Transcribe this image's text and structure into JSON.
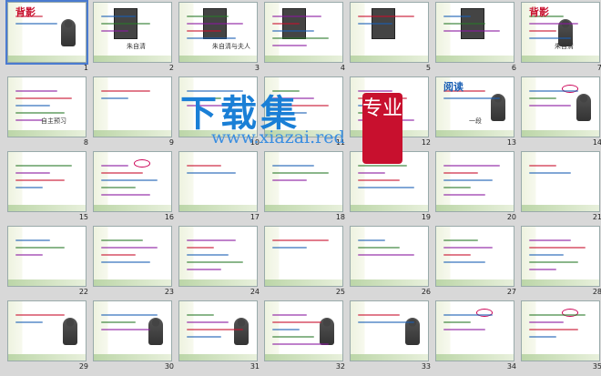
{
  "watermark": {
    "title": "下载集",
    "url": "www.xiazai.red",
    "stamp": "专业"
  },
  "slides": [
    {
      "n": "1",
      "title": "背影",
      "caption": ""
    },
    {
      "n": "2",
      "title": "",
      "caption": "朱自清"
    },
    {
      "n": "3",
      "title": "",
      "caption": "朱自清与夫人"
    },
    {
      "n": "4",
      "title": "",
      "caption": ""
    },
    {
      "n": "5",
      "title": "",
      "caption": ""
    },
    {
      "n": "6",
      "title": "",
      "caption": ""
    },
    {
      "n": "7",
      "title": "背影",
      "caption": "朱自清"
    },
    {
      "n": "8",
      "title": "",
      "caption": "自主预习"
    },
    {
      "n": "9",
      "title": "",
      "caption": ""
    },
    {
      "n": "10",
      "title": "",
      "caption": ""
    },
    {
      "n": "11",
      "title": "",
      "caption": ""
    },
    {
      "n": "12",
      "title": "",
      "caption": ""
    },
    {
      "n": "13",
      "title": "阅读",
      "caption": "一段"
    },
    {
      "n": "14",
      "title": "",
      "caption": ""
    },
    {
      "n": "15",
      "title": "",
      "caption": ""
    },
    {
      "n": "16",
      "title": "",
      "caption": ""
    },
    {
      "n": "17",
      "title": "",
      "caption": ""
    },
    {
      "n": "18",
      "title": "",
      "caption": ""
    },
    {
      "n": "19",
      "title": "",
      "caption": ""
    },
    {
      "n": "20",
      "title": "",
      "caption": ""
    },
    {
      "n": "21",
      "title": "",
      "caption": ""
    },
    {
      "n": "22",
      "title": "",
      "caption": ""
    },
    {
      "n": "23",
      "title": "",
      "caption": ""
    },
    {
      "n": "24",
      "title": "",
      "caption": ""
    },
    {
      "n": "25",
      "title": "",
      "caption": ""
    },
    {
      "n": "26",
      "title": "",
      "caption": ""
    },
    {
      "n": "27",
      "title": "",
      "caption": ""
    },
    {
      "n": "28",
      "title": "",
      "caption": ""
    },
    {
      "n": "29",
      "title": "",
      "caption": ""
    },
    {
      "n": "30",
      "title": "",
      "caption": ""
    },
    {
      "n": "31",
      "title": "",
      "caption": ""
    },
    {
      "n": "32",
      "title": "",
      "caption": ""
    },
    {
      "n": "33",
      "title": "",
      "caption": ""
    },
    {
      "n": "34",
      "title": "",
      "caption": ""
    },
    {
      "n": "35",
      "title": "",
      "caption": ""
    }
  ],
  "colors": {
    "accent_red": "#c8102e",
    "accent_blue": "#1a7fd6",
    "slide_green": "#bcd6a8"
  }
}
